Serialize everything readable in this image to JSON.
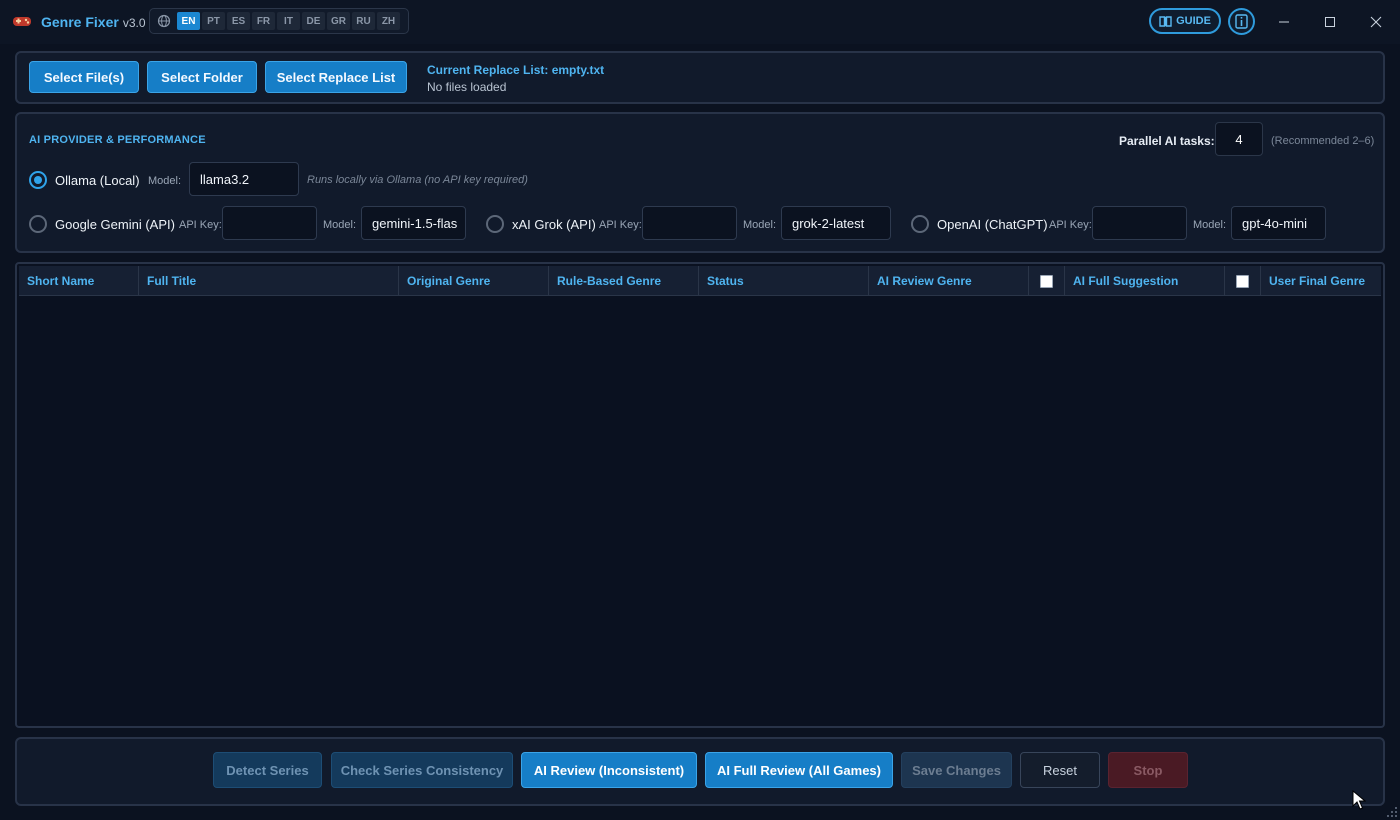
{
  "app": {
    "title": "Genre Fixer",
    "version": "v3.0"
  },
  "languages": [
    "EN",
    "PT",
    "ES",
    "FR",
    "IT",
    "DE",
    "GR",
    "RU",
    "ZH"
  ],
  "active_language": "EN",
  "header": {
    "guide_label": "GUIDE"
  },
  "file_bar": {
    "select_files": "Select File(s)",
    "select_folder": "Select Folder",
    "select_replace": "Select Replace List",
    "replace_list": "Current Replace List: empty.txt",
    "status": "No files loaded"
  },
  "ai": {
    "section_title": "AI PROVIDER & PERFORMANCE",
    "parallel_label": "Parallel AI tasks:",
    "parallel_value": "4",
    "parallel_hint": "(Recommended 2–6)",
    "model_label": "Model:",
    "api_key_label": "API Key:",
    "ollama": {
      "label": "Ollama (Local)",
      "model": "llama3.2",
      "hint": "Runs locally via Ollama (no API key required)"
    },
    "gemini": {
      "label": "Google Gemini (API)",
      "api_key": "",
      "model": "gemini-1.5-flas"
    },
    "grok": {
      "label": "xAI Grok (API)",
      "api_key": "",
      "model": "grok-2-latest"
    },
    "openai": {
      "label": "OpenAI (ChatGPT)",
      "api_key": "",
      "model": "gpt-4o-mini"
    }
  },
  "table": {
    "columns": [
      "Short Name",
      "Full Title",
      "Original Genre",
      "Rule-Based Genre",
      "Status",
      "AI Review Genre",
      "AI Full Suggestion",
      "User Final Genre"
    ]
  },
  "actions": {
    "detect_series": "Detect Series",
    "check_consistency": "Check Series Consistency",
    "ai_review": "AI Review (Inconsistent)",
    "ai_full_review": "AI Full Review (All Games)",
    "save_changes": "Save Changes",
    "reset": "Reset",
    "stop": "Stop"
  },
  "colors": {
    "accent": "#1b87d1",
    "background": "#0b1220",
    "panel": "#111a2b",
    "header_text": "#4fb4f0"
  }
}
